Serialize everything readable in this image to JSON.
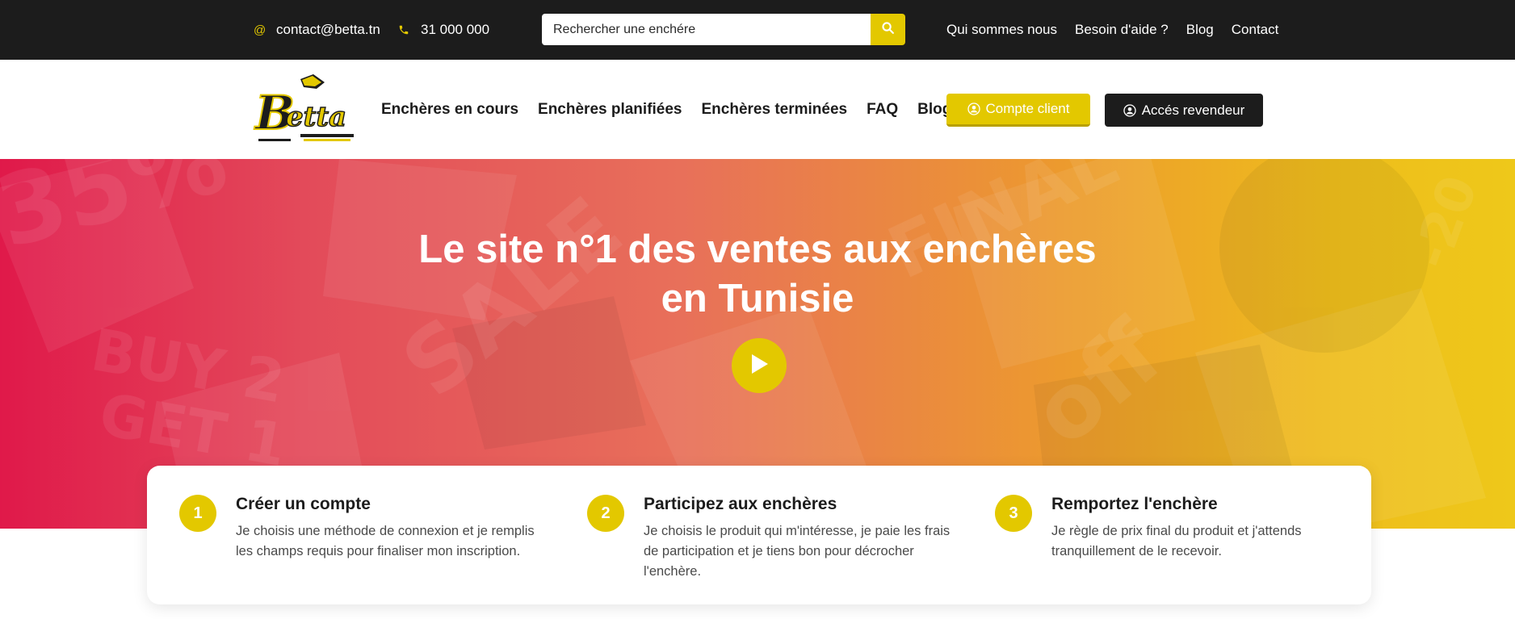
{
  "topbar": {
    "email": "contact@betta.tn",
    "email_icon": "at-icon",
    "phone": "31 000 000",
    "phone_icon": "phone-icon",
    "search_placeholder": "Rechercher une enchére",
    "links": [
      "Qui sommes nous",
      "Besoin d'aide ?",
      "Blog",
      "Contact"
    ]
  },
  "header": {
    "logo_text": "Betta",
    "nav": [
      "Enchères en cours",
      "Enchères planifiées",
      "Enchères terminées",
      "FAQ",
      "Blog"
    ],
    "client_button": "Compte client",
    "reseller_button": "Accés revendeur"
  },
  "hero": {
    "title_line1": "Le site n°1 des ventes aux enchères",
    "title_line2": "en Tunisie"
  },
  "steps": [
    {
      "number": "1",
      "title": "Créer un compte",
      "description": "Je choisis une méthode de connexion et je remplis les champs requis pour finaliser mon inscription."
    },
    {
      "number": "2",
      "title": "Participez aux enchères",
      "description": "Je choisis le produit qui m'intéresse, je paie les frais de participation et je tiens bon pour décrocher l'enchère."
    },
    {
      "number": "3",
      "title": "Remportez l'enchère",
      "description": "Je règle de prix final du produit et j'attends tranquillement de le recevoir."
    }
  ],
  "colors": {
    "accent": "#e3c800",
    "dark": "#1c1c1c",
    "hero_left": "#e0194a",
    "hero_right": "#eec81a"
  }
}
